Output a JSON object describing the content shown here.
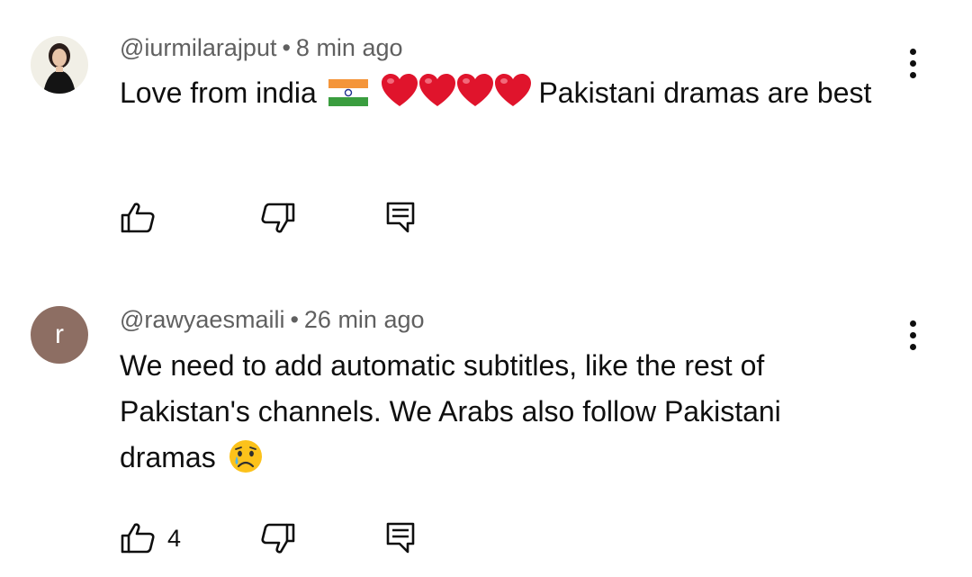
{
  "comments": [
    {
      "handle": "@iurmilarajput",
      "separator": "•",
      "time": "8 min ago",
      "text_part1": "Love from india",
      "flag_emoji_name": "india-flag-icon",
      "heart_emoji_name": "red-heart-icon",
      "heart_count": 4,
      "text_part2": "Pakistani dramas are best",
      "like_count": "",
      "avatar_type": "photo"
    },
    {
      "handle": "@rawyaesmaili",
      "separator": "•",
      "time": "26 min ago",
      "avatar_letter": "r",
      "avatar_color": "#8d6e63",
      "text": "We need to add automatic subtitles, like the rest of Pakistan's channels. We Arabs also follow Pakistani dramas",
      "trailing_emoji_name": "crying-face-icon",
      "like_count": "4",
      "avatar_type": "letter"
    }
  ],
  "icons": {
    "like": "thumbs-up-icon",
    "dislike": "thumbs-down-icon",
    "reply": "reply-icon",
    "menu": "more-vert-icon"
  },
  "colors": {
    "primary_text": "#0f0f0f",
    "secondary_text": "#606060",
    "heart": "#e0142c"
  }
}
